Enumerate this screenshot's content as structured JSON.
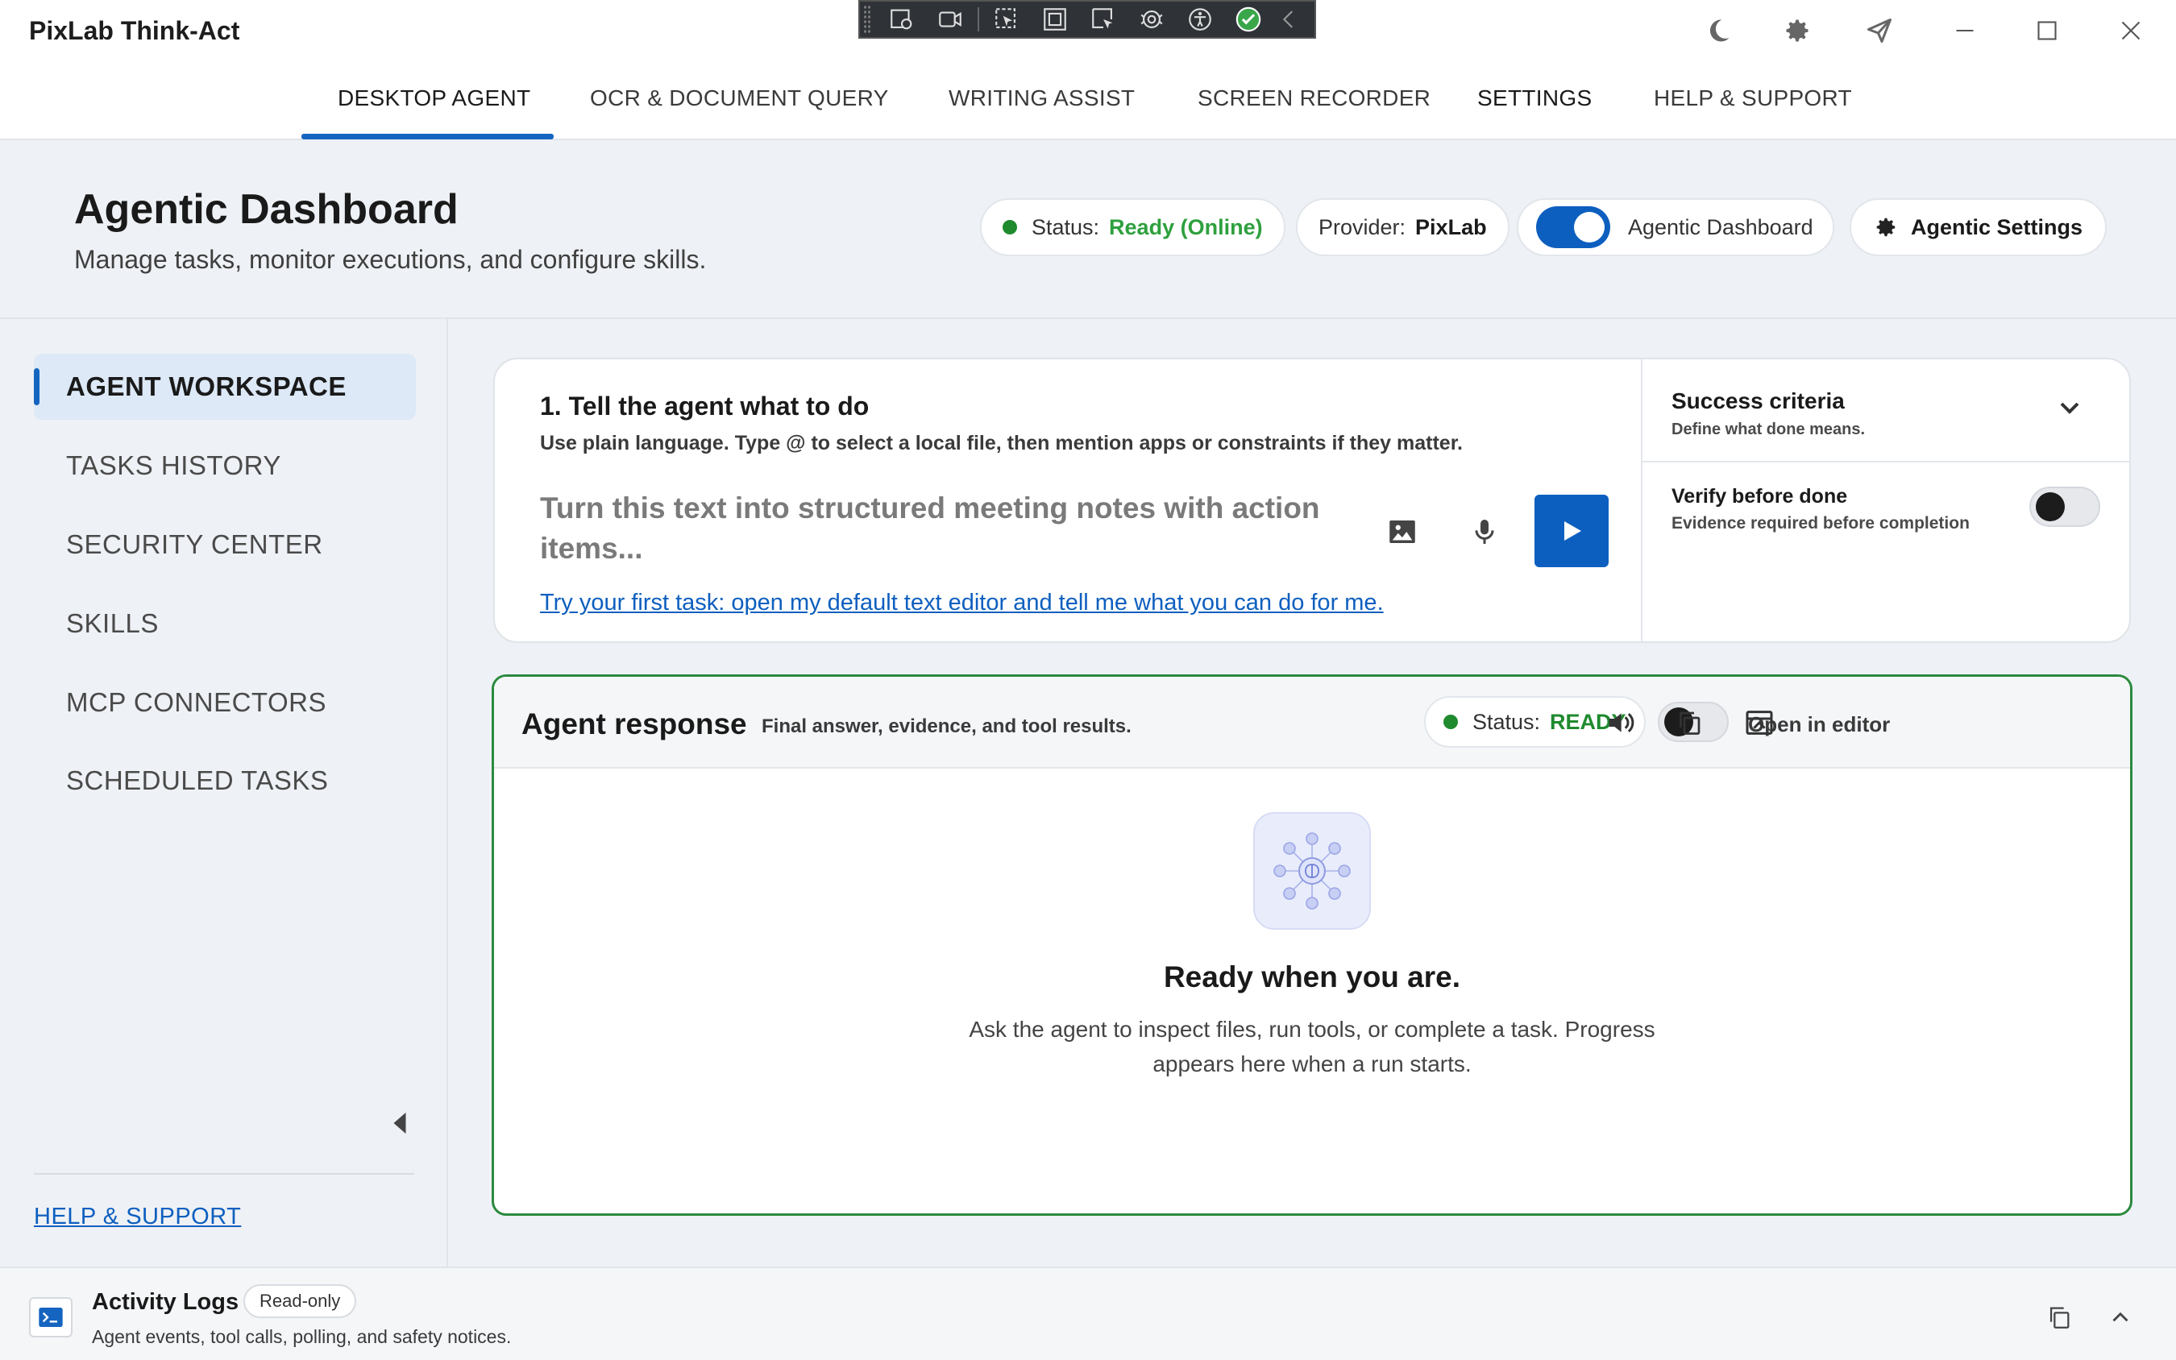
{
  "app": {
    "title": "PixLab Think-Act"
  },
  "window_controls": [
    "moon-icon",
    "gear-icon",
    "send-icon",
    "minimize-icon",
    "maximize-icon",
    "close-icon"
  ],
  "floating_toolbar": {
    "icons": [
      "capture-region-icon",
      "video-record-icon",
      "select-pointer-icon",
      "frame-icon",
      "pointer-region-icon",
      "brain-gears-icon",
      "accessibility-icon",
      "check-circle-icon",
      "collapse-left-icon"
    ]
  },
  "nav": {
    "tabs": [
      {
        "label": "DESKTOP AGENT",
        "active": true
      },
      {
        "label": "OCR & DOCUMENT QUERY"
      },
      {
        "label": "WRITING ASSIST"
      },
      {
        "label": "SCREEN RECORDER"
      },
      {
        "label": "SETTINGS"
      },
      {
        "label": "HELP & SUPPORT"
      }
    ]
  },
  "header": {
    "title": "Agentic Dashboard",
    "subtitle": "Manage tasks, monitor executions, and configure skills.",
    "status": {
      "label": "Status:",
      "value": "Ready (Online)"
    },
    "provider": {
      "label": "Provider:",
      "value": "PixLab"
    },
    "toggle": {
      "label": "Agentic Dashboard",
      "on": true
    },
    "settings_button": "Agentic Settings"
  },
  "sidebar": {
    "items": [
      {
        "label": "AGENT WORKSPACE",
        "active": true
      },
      {
        "label": "TASKS HISTORY"
      },
      {
        "label": "SECURITY CENTER"
      },
      {
        "label": "SKILLS"
      },
      {
        "label": "MCP CONNECTORS"
      },
      {
        "label": "SCHEDULED TASKS"
      }
    ],
    "help_link": "HELP & SUPPORT"
  },
  "task": {
    "heading": "1. Tell the agent what to do",
    "hint": "Use plain language. Type @ to select a local file, then mention apps or constraints if they matter.",
    "placeholder": "Turn this text into structured meeting notes with action items...",
    "first_task_link": "Try your first task: open my default text editor and tell me what you can do for me.",
    "success_criteria": {
      "title": "Success criteria",
      "subtitle": "Define what done means."
    },
    "verify": {
      "title": "Verify before done",
      "subtitle": "Evidence required before completion",
      "on": false
    }
  },
  "response": {
    "title": "Agent response",
    "subtitle": "Final answer, evidence, and tool results.",
    "status": {
      "label": "Status:",
      "value": "READY"
    },
    "open_in_editor": "Open in editor",
    "open_in_editor_on": false,
    "empty_title": "Ready when you are.",
    "empty_body": "Ask the agent to inspect files, run tools, or complete a task. Progress appears here when a run starts."
  },
  "logs": {
    "title": "Activity Logs",
    "badge": "Read-only",
    "subtitle": "Agent events, tool calls, polling, and safety notices."
  },
  "colors": {
    "accent": "#0d5fbf",
    "ready_green": "#2ea03e",
    "response_border": "#2b8a3e"
  }
}
